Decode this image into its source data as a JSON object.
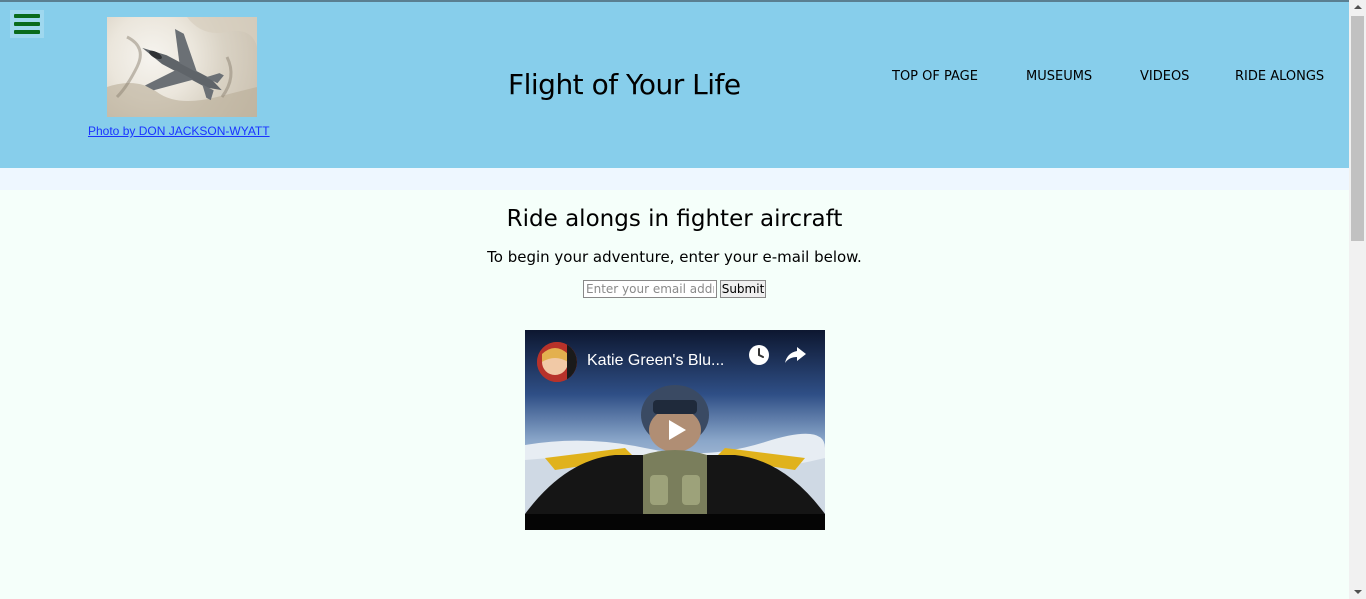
{
  "header": {
    "title": "Flight of Your Life",
    "photo_credit": "Photo by DON JACKSON-WYATT",
    "menu_icon": "hamburger-menu-icon",
    "nav": [
      {
        "label": "TOP OF PAGE"
      },
      {
        "label": "MUSEUMS"
      },
      {
        "label": "VIDEOS"
      },
      {
        "label": "RIDE ALONGS"
      }
    ]
  },
  "main": {
    "heading": "Ride alongs in fighter aircraft",
    "subheading": "To begin your adventure, enter your e-mail below.",
    "email_input": {
      "value": "",
      "placeholder": "Enter your email address"
    },
    "submit_label": "Submit",
    "video": {
      "title": "Katie Green's Blu...",
      "icons": [
        "watch-later-icon",
        "share-icon",
        "play-icon"
      ]
    }
  },
  "colors": {
    "header_bg": "#87ceeb",
    "page_bg": "#f5fffa",
    "menu_icon": "#0a6b1c",
    "link": "#1a33ff"
  }
}
